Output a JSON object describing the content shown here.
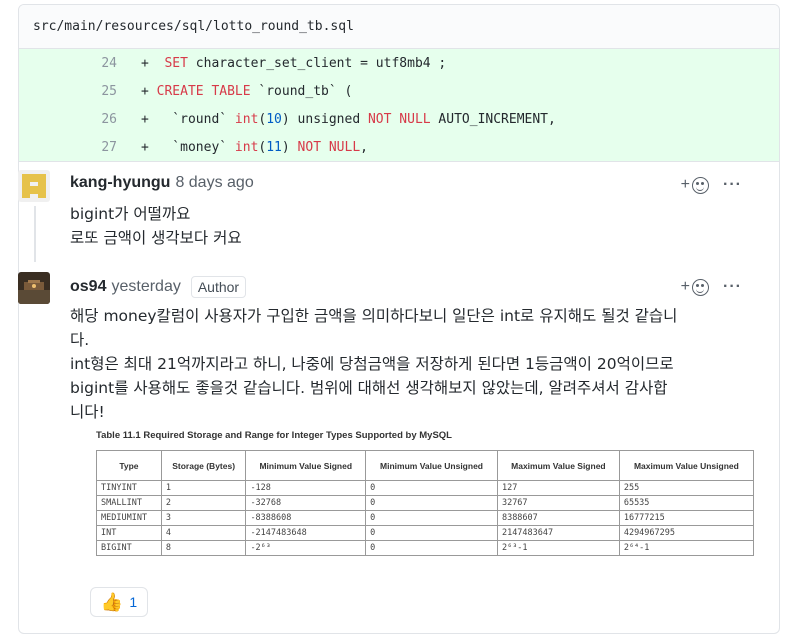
{
  "file": {
    "path": "src/main/resources/sql/lotto_round_tb.sql"
  },
  "diff": {
    "lines": [
      {
        "num": "24",
        "prefix": "+",
        "parts": [
          {
            "t": "  ",
            "c": ""
          },
          {
            "t": "SET",
            "c": "k"
          },
          {
            "t": " character_set_client = utf8mb4 ;",
            "c": ""
          }
        ]
      },
      {
        "num": "25",
        "prefix": "+",
        "parts": [
          {
            "t": " ",
            "c": ""
          },
          {
            "t": "CREATE TABLE",
            "c": "k"
          },
          {
            "t": " `round_tb` (",
            "c": ""
          }
        ]
      },
      {
        "num": "26",
        "prefix": "+",
        "parts": [
          {
            "t": "   `round` ",
            "c": ""
          },
          {
            "t": "int",
            "c": "k"
          },
          {
            "t": "(",
            "c": ""
          },
          {
            "t": "10",
            "c": "n"
          },
          {
            "t": ") unsigned ",
            "c": ""
          },
          {
            "t": "NOT NULL",
            "c": "k"
          },
          {
            "t": " AUTO_INCREMENT,",
            "c": ""
          }
        ]
      },
      {
        "num": "27",
        "prefix": "+",
        "parts": [
          {
            "t": "   `money` ",
            "c": ""
          },
          {
            "t": "int",
            "c": "k"
          },
          {
            "t": "(",
            "c": ""
          },
          {
            "t": "11",
            "c": "n"
          },
          {
            "t": ") ",
            "c": ""
          },
          {
            "t": "NOT NULL",
            "c": "k"
          },
          {
            "t": ",",
            "c": ""
          }
        ]
      }
    ]
  },
  "comments": [
    {
      "author": "kang-hyungu",
      "time": "8 days ago",
      "badge": "",
      "lines": [
        "bigint가 어떨까요",
        "로또 금액이 생각보다 커요"
      ]
    },
    {
      "author": "os94",
      "time": "yesterday",
      "badge": "Author",
      "lines": [
        "해당 money칼럼이 사용자가 구입한 금액을 의미하다보니 일단은 int로 유지해도 될것 같습니",
        "다.",
        "int형은 최대 21억까지라고 하니, 나중에 당첨금액을 저장하게 된다면 1등금액이 20억이므로",
        "bigint를 사용해도 좋을것 같습니다. 범위에 대해선 생각해보지 않았는데, 알려주셔서 감사합",
        "니다!"
      ]
    }
  ],
  "actions": {
    "add_reaction": "+",
    "more": "···"
  },
  "mysql_table": {
    "title": "Table 11.1 Required Storage and Range for Integer Types Supported by MySQL",
    "headers": [
      "Type",
      "Storage (Bytes)",
      "Minimum Value Signed",
      "Minimum Value Unsigned",
      "Maximum Value Signed",
      "Maximum Value Unsigned"
    ],
    "rows": [
      [
        "TINYINT",
        "1",
        "-128",
        "0",
        "127",
        "255"
      ],
      [
        "SMALLINT",
        "2",
        "-32768",
        "0",
        "32767",
        "65535"
      ],
      [
        "MEDIUMINT",
        "3",
        "-8388608",
        "0",
        "8388607",
        "16777215"
      ],
      [
        "INT",
        "4",
        "-2147483648",
        "0",
        "2147483647",
        "4294967295"
      ],
      [
        "BIGINT",
        "8",
        "-2⁶³",
        "0",
        "2⁶³-1",
        "2⁶⁴-1"
      ]
    ]
  },
  "reaction": {
    "emoji": "👍",
    "count": "1"
  },
  "colors": {
    "diff_add_bg": "#e6ffed",
    "keyword": "#d73a49",
    "number": "#005cc5",
    "link": "#0366d6"
  }
}
